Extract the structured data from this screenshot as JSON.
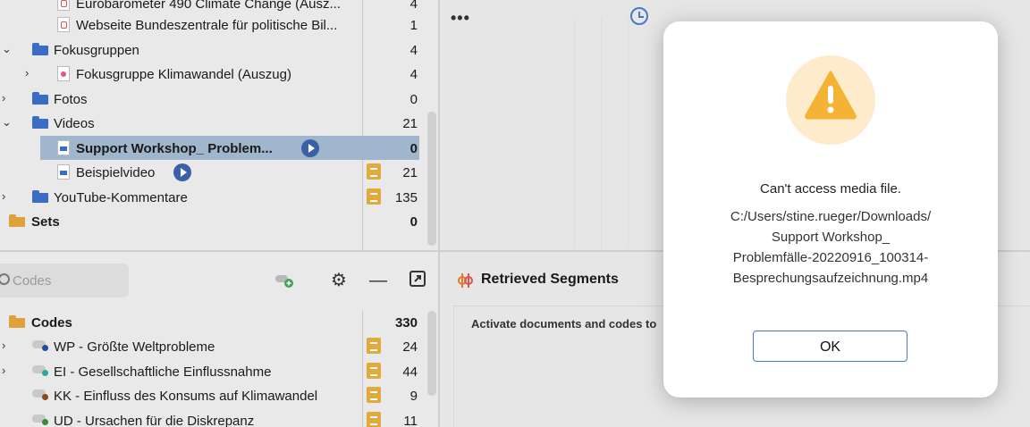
{
  "documents": {
    "rows": [
      {
        "label": "Eurobarometer 490 Climate Change (Ausz...",
        "count": "4"
      },
      {
        "label": "Webseite Bundeszentrale für politische Bil...",
        "count": "1"
      },
      {
        "label": "Fokusgruppen",
        "count": "4"
      },
      {
        "label": "Fokusgruppe Klimawandel (Auszug)",
        "count": "4"
      },
      {
        "label": "Fotos",
        "count": "0"
      },
      {
        "label": "Videos",
        "count": "21"
      },
      {
        "label": "Support Workshop_ Problem...",
        "count": "0"
      },
      {
        "label": "Beispielvideo",
        "count": "21"
      },
      {
        "label": "YouTube-Kommentare",
        "count": "135"
      },
      {
        "label": "Sets",
        "count": "0"
      }
    ]
  },
  "codes": {
    "search_placeholder": "Codes",
    "root": {
      "label": "Codes",
      "count": "330"
    },
    "items": [
      {
        "label": "WP - Größte Weltprobleme",
        "count": "24",
        "dot_color": "#1f4f9e"
      },
      {
        "label": "EI - Gesellschaftliche Einflussnahme",
        "count": "44",
        "dot_color": "#2aa7a0"
      },
      {
        "label": "KK - Einfluss des Konsums auf Klimawandel",
        "count": "9",
        "dot_color": "#8a4a1e"
      },
      {
        "label": "UD - Ursachen für die Diskrepanz",
        "count": "11",
        "dot_color": "#3a8a3a"
      }
    ]
  },
  "segments": {
    "title": "Retrieved Segments",
    "message": "Activate documents and codes to"
  },
  "viewer": {
    "more": "•••"
  },
  "dialog": {
    "title": "Can't access media file.",
    "path_lines": [
      "C:/Users/stine.rueger/Downloads/",
      "Support Workshop_",
      "Problemfälle-20220916_100314-",
      "Besprechungsaufzeichnung.mp4"
    ],
    "ok_label": "OK",
    "accent": "#f5b335"
  }
}
